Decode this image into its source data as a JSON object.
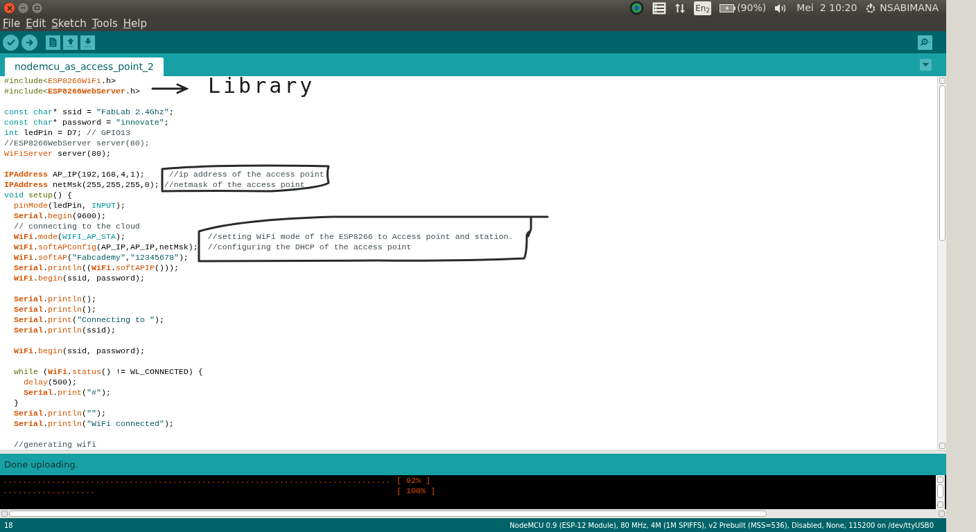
{
  "top_bar": {
    "window_controls": [
      {
        "kind": "close"
      },
      {
        "kind": "minimize"
      },
      {
        "kind": "maximize"
      }
    ],
    "indicators": {
      "keyboard": "En$_{2}$",
      "battery": "(90%)",
      "clock": "Mei  2 10:20",
      "user": "NSABIMANA"
    }
  },
  "menu": [
    "File",
    "Edit",
    "Sketch",
    "Tools",
    "Help"
  ],
  "toolbar": [
    {
      "kind": "verify"
    },
    {
      "kind": "upload"
    },
    {
      "kind": "new"
    },
    {
      "kind": "open"
    },
    {
      "kind": "save"
    }
  ],
  "tabs": [
    {
      "label": "nodemcu_as_access_point_2",
      "selected": true
    }
  ],
  "annotations": {
    "library_label": "Library"
  },
  "code": [
    {
      "kind": "code",
      "tokens": [
        {
          "kind": "pre",
          "text": "#include<"
        },
        {
          "kind": "lib",
          "text": "ESP8266WiFi"
        },
        {
          "kind": "plain",
          "text": ".h>"
        }
      ]
    },
    {
      "kind": "code",
      "tokens": [
        {
          "kind": "pre",
          "text": "#include<"
        },
        {
          "kind": "obj",
          "text": "ESP8266WebServer"
        },
        {
          "kind": "plain",
          "text": ".h>"
        }
      ]
    },
    {
      "kind": "blank"
    },
    {
      "kind": "code",
      "tokens": [
        {
          "kind": "type",
          "text": "const char"
        },
        {
          "kind": "plain",
          "text": "* ssid = "
        },
        {
          "kind": "string",
          "text": "\"FabLab 2.4Ghz\""
        },
        {
          "kind": "plain",
          "text": ";"
        }
      ]
    },
    {
      "kind": "code",
      "tokens": [
        {
          "kind": "type",
          "text": "const char"
        },
        {
          "kind": "plain",
          "text": "* password = "
        },
        {
          "kind": "string",
          "text": "\"innovate\""
        },
        {
          "kind": "plain",
          "text": ";"
        }
      ]
    },
    {
      "kind": "code",
      "tokens": [
        {
          "kind": "type",
          "text": "int"
        },
        {
          "kind": "plain",
          "text": " ledPin = D7; "
        },
        {
          "kind": "comment",
          "text": "// GPIO13"
        }
      ]
    },
    {
      "kind": "code",
      "tokens": [
        {
          "kind": "comment",
          "text": "//ESP8266WebServer server(80);"
        }
      ]
    },
    {
      "kind": "code",
      "tokens": [
        {
          "kind": "lib",
          "text": "WiFiServer"
        },
        {
          "kind": "plain",
          "text": " server(80);"
        }
      ]
    },
    {
      "kind": "blank"
    },
    {
      "kind": "code",
      "tokens": [
        {
          "kind": "obj",
          "text": "IPAddress"
        },
        {
          "kind": "plain",
          "text": " AP_IP(192,168,4,1);     "
        },
        {
          "kind": "comment",
          "text": "//ip address of the access point"
        }
      ]
    },
    {
      "kind": "code",
      "tokens": [
        {
          "kind": "obj",
          "text": "IPAddress"
        },
        {
          "kind": "plain",
          "text": " netMsk(255,255,255,0); "
        },
        {
          "kind": "comment",
          "text": "//netmask of the access point"
        }
      ]
    },
    {
      "kind": "code",
      "tokens": [
        {
          "kind": "type",
          "text": "void "
        },
        {
          "kind": "pre",
          "text": "setup"
        },
        {
          "kind": "plain",
          "text": "() {"
        }
      ]
    },
    {
      "kind": "indent",
      "tokens": [
        {
          "kind": "func",
          "text": "pinMode"
        },
        {
          "kind": "plain",
          "text": "(ledPin, "
        },
        {
          "kind": "type",
          "text": "INPUT"
        },
        {
          "kind": "plain",
          "text": ");"
        }
      ]
    },
    {
      "kind": "indent",
      "tokens": [
        {
          "kind": "obj",
          "text": "Serial"
        },
        {
          "kind": "plain",
          "text": "."
        },
        {
          "kind": "func",
          "text": "begin"
        },
        {
          "kind": "plain",
          "text": "(9600);"
        }
      ]
    },
    {
      "kind": "indent",
      "tokens": [
        {
          "kind": "comment",
          "text": "// connecting to the cloud"
        }
      ]
    },
    {
      "kind": "indent",
      "tokens": [
        {
          "kind": "obj",
          "text": "WiFi"
        },
        {
          "kind": "plain",
          "text": "."
        },
        {
          "kind": "func",
          "text": "mode"
        },
        {
          "kind": "plain",
          "text": "("
        },
        {
          "kind": "type",
          "text": "WIFI_AP_STA"
        },
        {
          "kind": "plain",
          "text": ");                 "
        },
        {
          "kind": "comment",
          "text": "//setting WiFi mode of the ESP8266 to Access point and station."
        }
      ]
    },
    {
      "kind": "indent",
      "tokens": [
        {
          "kind": "obj",
          "text": "WiFi"
        },
        {
          "kind": "plain",
          "text": "."
        },
        {
          "kind": "func",
          "text": "softAPConfig"
        },
        {
          "kind": "plain",
          "text": "(AP_IP,AP_IP,netMsk);  "
        },
        {
          "kind": "comment",
          "text": "//configuring the DHCP of the access point"
        }
      ]
    },
    {
      "kind": "indent",
      "tokens": [
        {
          "kind": "obj",
          "text": "WiFi"
        },
        {
          "kind": "plain",
          "text": "."
        },
        {
          "kind": "func",
          "text": "softAP"
        },
        {
          "kind": "plain",
          "text": "("
        },
        {
          "kind": "string",
          "text": "\"Fabcademy\""
        },
        {
          "kind": "plain",
          "text": ","
        },
        {
          "kind": "string",
          "text": "\"12345678\""
        },
        {
          "kind": "plain",
          "text": ");"
        }
      ]
    },
    {
      "kind": "indent",
      "tokens": [
        {
          "kind": "obj",
          "text": "Serial"
        },
        {
          "kind": "plain",
          "text": "."
        },
        {
          "kind": "func",
          "text": "println"
        },
        {
          "kind": "plain",
          "text": "(("
        },
        {
          "kind": "obj",
          "text": "WiFi"
        },
        {
          "kind": "plain",
          "text": "."
        },
        {
          "kind": "func",
          "text": "softAPIP"
        },
        {
          "kind": "plain",
          "text": "()));"
        }
      ]
    },
    {
      "kind": "indent",
      "tokens": [
        {
          "kind": "obj",
          "text": "WiFi"
        },
        {
          "kind": "plain",
          "text": "."
        },
        {
          "kind": "func",
          "text": "begin"
        },
        {
          "kind": "plain",
          "text": "(ssid, password);"
        }
      ]
    },
    {
      "kind": "blank"
    },
    {
      "kind": "indent",
      "tokens": [
        {
          "kind": "obj",
          "text": "Serial"
        },
        {
          "kind": "plain",
          "text": "."
        },
        {
          "kind": "func",
          "text": "println"
        },
        {
          "kind": "plain",
          "text": "();"
        }
      ]
    },
    {
      "kind": "indent",
      "tokens": [
        {
          "kind": "obj",
          "text": "Serial"
        },
        {
          "kind": "plain",
          "text": "."
        },
        {
          "kind": "func",
          "text": "println"
        },
        {
          "kind": "plain",
          "text": "();"
        }
      ]
    },
    {
      "kind": "indent",
      "tokens": [
        {
          "kind": "obj",
          "text": "Serial"
        },
        {
          "kind": "plain",
          "text": "."
        },
        {
          "kind": "func",
          "text": "print"
        },
        {
          "kind": "plain",
          "text": "("
        },
        {
          "kind": "string",
          "text": "\"Connecting to \""
        },
        {
          "kind": "plain",
          "text": ");"
        }
      ]
    },
    {
      "kind": "indent",
      "tokens": [
        {
          "kind": "obj",
          "text": "Serial"
        },
        {
          "kind": "plain",
          "text": "."
        },
        {
          "kind": "func",
          "text": "println"
        },
        {
          "kind": "plain",
          "text": "(ssid);"
        }
      ]
    },
    {
      "kind": "blank"
    },
    {
      "kind": "indent",
      "tokens": [
        {
          "kind": "obj",
          "text": "WiFi"
        },
        {
          "kind": "plain",
          "text": "."
        },
        {
          "kind": "func",
          "text": "begin"
        },
        {
          "kind": "plain",
          "text": "(ssid, password);"
        }
      ]
    },
    {
      "kind": "blank"
    },
    {
      "kind": "indent",
      "tokens": [
        {
          "kind": "pre",
          "text": "while"
        },
        {
          "kind": "plain",
          "text": " ("
        },
        {
          "kind": "obj",
          "text": "WiFi"
        },
        {
          "kind": "plain",
          "text": "."
        },
        {
          "kind": "func",
          "text": "status"
        },
        {
          "kind": "plain",
          "text": "() != WL_CONNECTED) {"
        }
      ]
    },
    {
      "kind": "indent2",
      "tokens": [
        {
          "kind": "func",
          "text": "delay"
        },
        {
          "kind": "plain",
          "text": "(500);"
        }
      ]
    },
    {
      "kind": "indent2",
      "tokens": [
        {
          "kind": "obj",
          "text": "Serial"
        },
        {
          "kind": "plain",
          "text": "."
        },
        {
          "kind": "func",
          "text": "print"
        },
        {
          "kind": "plain",
          "text": "("
        },
        {
          "kind": "string",
          "text": "\"#\""
        },
        {
          "kind": "plain",
          "text": ");"
        }
      ]
    },
    {
      "kind": "indent",
      "tokens": [
        {
          "kind": "plain",
          "text": "}"
        }
      ]
    },
    {
      "kind": "indent",
      "tokens": [
        {
          "kind": "obj",
          "text": "Serial"
        },
        {
          "kind": "plain",
          "text": "."
        },
        {
          "kind": "func",
          "text": "println"
        },
        {
          "kind": "plain",
          "text": "("
        },
        {
          "kind": "string",
          "text": "\"\""
        },
        {
          "kind": "plain",
          "text": ");"
        }
      ]
    },
    {
      "kind": "indent",
      "tokens": [
        {
          "kind": "obj",
          "text": "Serial"
        },
        {
          "kind": "plain",
          "text": "."
        },
        {
          "kind": "func",
          "text": "println"
        },
        {
          "kind": "plain",
          "text": "("
        },
        {
          "kind": "string",
          "text": "\"WiFi connected\""
        },
        {
          "kind": "plain",
          "text": ");"
        }
      ]
    },
    {
      "kind": "blank"
    },
    {
      "kind": "indent",
      "tokens": [
        {
          "kind": "comment",
          "text": "//generating wifi"
        }
      ]
    }
  ],
  "status": "Done uploading.",
  "console": [
    {
      "dots": "................................................................................",
      "reading": "[ 92% ]"
    },
    {
      "dots": "...................",
      "reading": "[ 100% ]"
    }
  ],
  "footer": {
    "line": "18",
    "board": "NodeMCU 0.9 (ESP-12 Module), 80 MHz, 4M (1M SPIFFS), v2 Prebuilt (MSS=536), Disabled, None, 115200 on /dev/ttyUSB0"
  }
}
